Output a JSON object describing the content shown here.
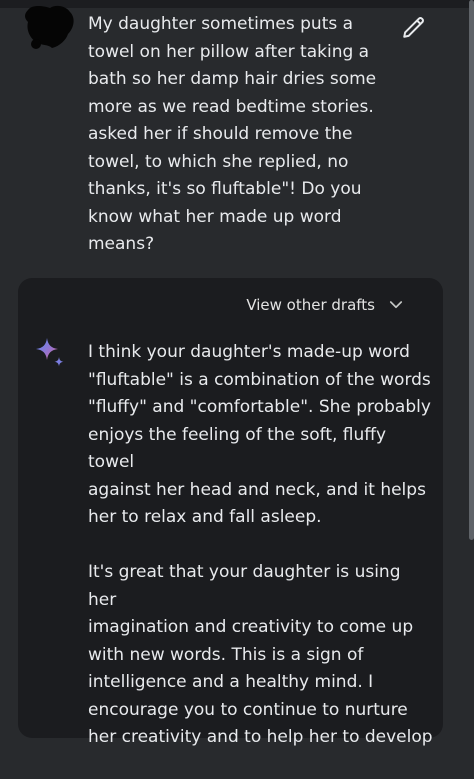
{
  "user_message": {
    "text": "My daughter sometimes puts a\ntowel on her pillow after taking a\nbath so her damp hair dries some\nmore as we read bedtime stories.\nasked her if should remove the\ntowel, to which she replied, no\nthanks, it's so fluftable\"! Do you\nknow what her made up word\nmeans?"
  },
  "response": {
    "view_drafts_label": "View other drafts",
    "paragraphs": [
      "I think your daughter's made-up word\n\"fluftable\" is a combination of the words\n\"fluffy\" and \"comfortable\". She probably\nenjoys the feeling of the soft, fluffy towel\nagainst her head and neck, and it helps\nher to relax and fall asleep.",
      "It's great that your daughter is using her\nimagination and creativity to come up\nwith new words. This is a sign of\nintelligence and a healthy mind. I\nencourage you to continue to nurture\nher creativity and to help her to develop"
    ]
  },
  "icons": {
    "edit": "pencil-icon",
    "drafts": "chevron-down-icon",
    "assistant": "sparkle-icon"
  },
  "colors": {
    "background": "#282a2d",
    "card": "#1b1c1f",
    "text": "#e8eaed",
    "sparkle_blue": "#4f8bf5",
    "sparkle_pink": "#d96570"
  }
}
